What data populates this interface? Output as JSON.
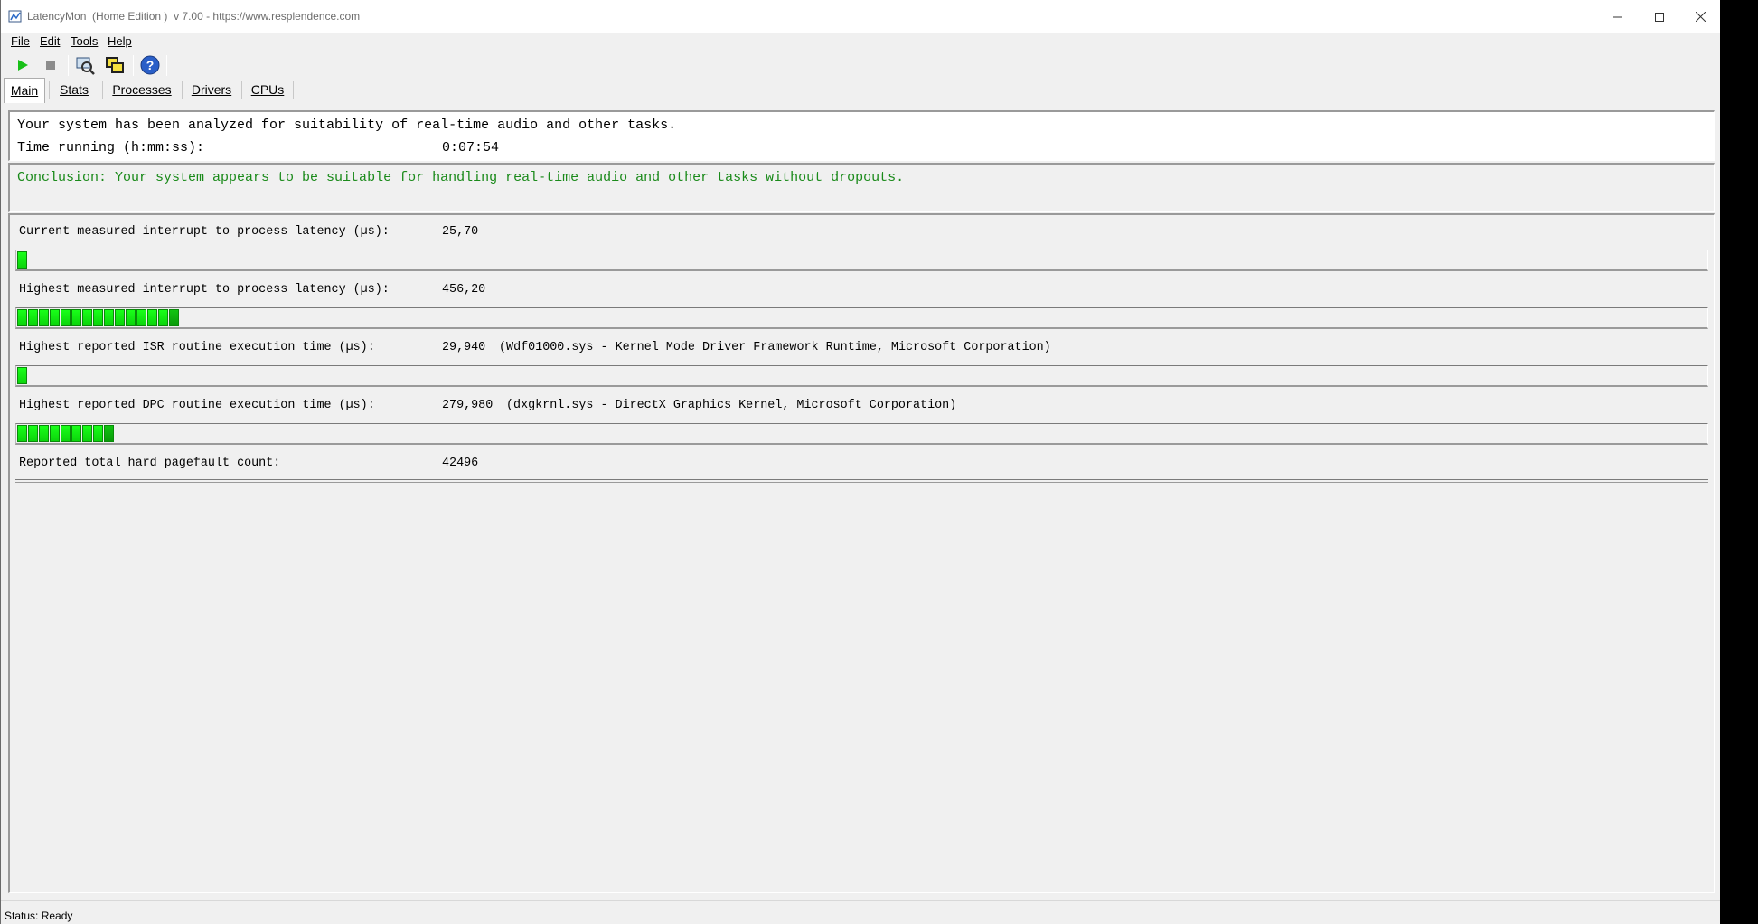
{
  "window": {
    "title": "LatencyMon  (Home Edition )  v 7.00 - https://www.resplendence.com"
  },
  "menu": {
    "items": [
      {
        "label": "File"
      },
      {
        "label": "Edit"
      },
      {
        "label": "Tools"
      },
      {
        "label": "Help"
      }
    ]
  },
  "toolbar": {
    "buttons": [
      "play-icon",
      "stop-icon",
      "analyze-icon",
      "windows-icon",
      "help-icon"
    ]
  },
  "tabs": [
    {
      "label": "Main",
      "active": true
    },
    {
      "label": "Stats",
      "active": false
    },
    {
      "label": "Processes",
      "active": false
    },
    {
      "label": "Drivers",
      "active": false
    },
    {
      "label": "CPUs",
      "active": false
    }
  ],
  "summary": {
    "analyzed_text": "Your system has been analyzed for suitability of real-time audio and other tasks.",
    "time_label": "Time running (h:mm:ss):",
    "time_value": "0:07:54"
  },
  "conclusion": {
    "text": "Conclusion: Your system appears to be suitable for handling real-time audio and other tasks without dropouts.",
    "color": "#1a8a1a"
  },
  "metrics": [
    {
      "label": "Current measured interrupt to process latency (µs):",
      "value": "25,70",
      "detail": "",
      "bar_segments": 1
    },
    {
      "label": "Highest measured interrupt to process latency (µs):",
      "value": "456,20",
      "detail": "",
      "bar_segments": 15
    },
    {
      "label": "Highest reported ISR routine execution time (µs):",
      "value": "29,940",
      "detail": "(Wdf01000.sys - Kernel Mode Driver Framework Runtime, Microsoft Corporation)",
      "bar_segments": 1
    },
    {
      "label": "Highest reported DPC routine execution time (µs):",
      "value": "279,980",
      "detail": "(dxgkrnl.sys - DirectX Graphics Kernel, Microsoft Corporation)",
      "bar_segments": 9
    },
    {
      "label": "Reported total hard pagefault count:",
      "value": "42496",
      "detail": "",
      "bar_segments": null
    }
  ],
  "status": {
    "text": "Status: Ready"
  },
  "colors": {
    "bar_green": "#19ff19",
    "bar_green_dark": "#0a9a0a"
  }
}
